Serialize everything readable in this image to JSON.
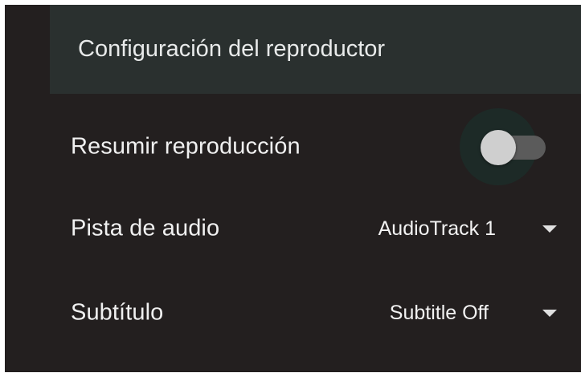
{
  "header": {
    "title": "Configuración del reproductor"
  },
  "settings": {
    "resume": {
      "label": "Resumir reproducción",
      "enabled": false
    },
    "audio_track": {
      "label": "Pista de audio",
      "selected": "AudioTrack 1",
      "icon": "chevron-down-icon"
    },
    "subtitle": {
      "label": "Subtítulo",
      "selected": "Subtitle Off",
      "icon": "chevron-down-icon"
    }
  },
  "colors": {
    "panel_bg": "#231f1f",
    "header_bg": "#2a302f",
    "text": "#f0f0f0"
  }
}
